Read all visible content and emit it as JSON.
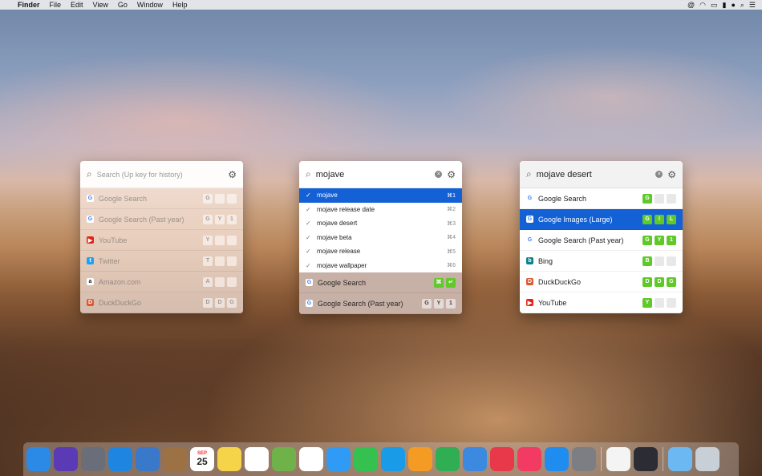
{
  "menubar": {
    "apple_icon": "apple-icon",
    "app_name": "Finder",
    "menus": [
      "File",
      "Edit",
      "View",
      "Go",
      "Window",
      "Help"
    ],
    "status_icons": [
      "at-icon",
      "wifi-icon",
      "airplay-icon",
      "battery-icon",
      "user-icon",
      "search-icon",
      "list-icon"
    ]
  },
  "panel_history": {
    "placeholder": "Search (Up key for history)",
    "rows": [
      {
        "label": "Google Search",
        "favicon": "G",
        "keys": [
          "G",
          "",
          ""
        ]
      },
      {
        "label": "Google Search (Past year)",
        "favicon": "G",
        "keys": [
          "G",
          "Y",
          "1"
        ]
      },
      {
        "label": "YouTube",
        "favicon": "▶",
        "keys": [
          "Y",
          "",
          ""
        ]
      },
      {
        "label": "Twitter",
        "favicon": "t",
        "keys": [
          "T",
          "",
          ""
        ]
      },
      {
        "label": "Amazon.com",
        "favicon": "a",
        "keys": [
          "A",
          "",
          ""
        ]
      },
      {
        "label": "DuckDuckGo",
        "favicon": "D",
        "keys": [
          "D",
          "D",
          "G"
        ]
      }
    ]
  },
  "panel_suggestions": {
    "query": "mojave",
    "suggestions": [
      {
        "label": "mojave",
        "shortcut": "⌘1"
      },
      {
        "label": "mojave release date",
        "shortcut": "⌘2"
      },
      {
        "label": "mojave desert",
        "shortcut": "⌘3"
      },
      {
        "label": "mojave beta",
        "shortcut": "⌘4"
      },
      {
        "label": "mojave release",
        "shortcut": "⌘5"
      },
      {
        "label": "mojave wallpaper",
        "shortcut": "⌘6"
      }
    ],
    "engines": [
      {
        "label": "Google Search",
        "favicon": "G",
        "keys": [
          "⌘",
          "↵"
        ]
      },
      {
        "label": "Google Search (Past year)",
        "favicon": "G",
        "keys": [
          "G",
          "Y",
          "1"
        ]
      }
    ]
  },
  "panel_engines": {
    "query": "mojave desert",
    "rows": [
      {
        "label": "Google Search",
        "favicon": "G",
        "keys": [
          "G",
          "",
          ""
        ]
      },
      {
        "label": "Google Images (Large)",
        "favicon": "G",
        "keys": [
          "G",
          "I",
          "L"
        ]
      },
      {
        "label": "Google Search (Past year)",
        "favicon": "G",
        "keys": [
          "G",
          "Y",
          "1"
        ]
      },
      {
        "label": "Bing",
        "favicon": "b",
        "keys": [
          "B",
          "",
          ""
        ]
      },
      {
        "label": "DuckDuckGo",
        "favicon": "D",
        "keys": [
          "D",
          "D",
          "G"
        ]
      },
      {
        "label": "YouTube",
        "favicon": "▶",
        "keys": [
          "Y",
          "",
          ""
        ]
      }
    ]
  },
  "dock": {
    "apps": [
      "finder-icon",
      "siri-icon",
      "launchpad-icon",
      "safari-icon",
      "mail-stamp-icon",
      "contacts-icon",
      "calendar-icon",
      "notes-icon",
      "reminders-icon",
      "maps-icon",
      "photos-icon",
      "messages-icon",
      "facetime-icon",
      "helpdesk-icon",
      "pages-icon",
      "numbers-icon",
      "keynote-icon",
      "news-icon",
      "music-icon",
      "app-store-icon",
      "system-preferences-icon",
      "textedit-icon",
      "quicktime-icon",
      "downloads-folder-icon",
      "trash-icon"
    ],
    "calendar_month": "SEP",
    "calendar_day": "25"
  },
  "colors": {
    "selection": "#1461d6",
    "key_green": "#5fc928"
  }
}
